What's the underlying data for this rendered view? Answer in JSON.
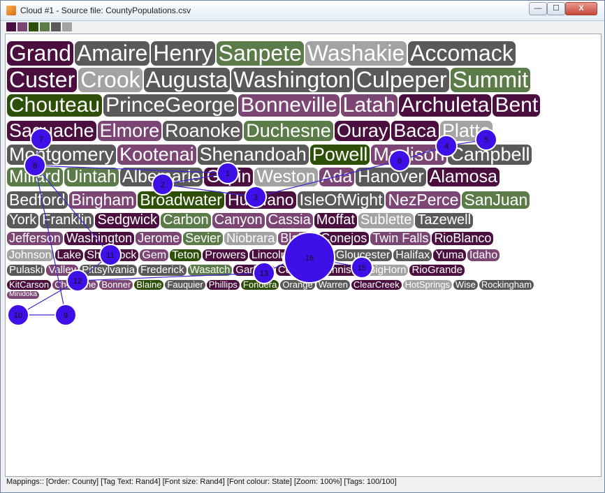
{
  "window": {
    "title": "Cloud #1 - Source file: CountyPopulations.csv"
  },
  "window_controls": {
    "minimize": "—",
    "maximize": "☐",
    "close": "X"
  },
  "palette": [
    "#4b0f3f",
    "#7c4674",
    "#2e4f07",
    "#5b7b48",
    "#595959",
    "#a3a3a3"
  ],
  "status": "Mappings:: [Order: County]  [Tag Text: Rand4]  [Font size: Rand4]  [Font colour: State]  [Zoom: 100%]  [Tags: 100/100]",
  "tags": [
    {
      "text": "Grand",
      "color": "#4b0f3f"
    },
    {
      "text": "Amaire",
      "color": "#595959"
    },
    {
      "text": "Henry",
      "color": "#595959"
    },
    {
      "text": "Sanpete",
      "color": "#5b7b48"
    },
    {
      "text": "Washakie",
      "color": "#a3a3a3"
    },
    {
      "text": "Accomack",
      "color": "#595959"
    },
    {
      "text": "Custer",
      "color": "#4b0f3f"
    },
    {
      "text": "Crook",
      "color": "#a3a3a3"
    },
    {
      "text": "Augusta",
      "color": "#595959"
    },
    {
      "text": "Washington",
      "color": "#595959"
    },
    {
      "text": "Culpeper",
      "color": "#595959"
    },
    {
      "text": "Summit",
      "color": "#5b7b48"
    },
    {
      "text": "Chouteau",
      "color": "#2e4f07"
    },
    {
      "text": "PrinceGeorge",
      "color": "#595959"
    },
    {
      "text": "Bonneville",
      "color": "#7c4674"
    },
    {
      "text": "Latah",
      "color": "#7c4674"
    },
    {
      "text": "Archuleta",
      "color": "#4b0f3f"
    },
    {
      "text": "Bent",
      "color": "#4b0f3f"
    },
    {
      "text": "Saguache",
      "color": "#4b0f3f"
    },
    {
      "text": "Elmore",
      "color": "#7c4674"
    },
    {
      "text": "Roanoke",
      "color": "#595959"
    },
    {
      "text": "Duchesne",
      "color": "#5b7b48"
    },
    {
      "text": "Ouray",
      "color": "#4b0f3f"
    },
    {
      "text": "Baca",
      "color": "#4b0f3f"
    },
    {
      "text": "Platte",
      "color": "#a3a3a3"
    },
    {
      "text": "Montgomery",
      "color": "#595959"
    },
    {
      "text": "Kootenai",
      "color": "#7c4674"
    },
    {
      "text": "Shenandoah",
      "color": "#595959"
    },
    {
      "text": "Powell",
      "color": "#2e4f07"
    },
    {
      "text": "Madison",
      "color": "#7c4674"
    },
    {
      "text": "Campbell",
      "color": "#595959"
    },
    {
      "text": "Millard",
      "color": "#5b7b48"
    },
    {
      "text": "Uintah",
      "color": "#5b7b48"
    },
    {
      "text": "Albemarle",
      "color": "#595959"
    },
    {
      "text": "Gilpin",
      "color": "#4b0f3f"
    },
    {
      "text": "Weston",
      "color": "#a3a3a3"
    },
    {
      "text": "Ada",
      "color": "#7c4674"
    },
    {
      "text": "Hanover",
      "color": "#595959"
    },
    {
      "text": "Alamosa",
      "color": "#4b0f3f"
    },
    {
      "text": "Bedford",
      "color": "#595959"
    },
    {
      "text": "Bingham",
      "color": "#7c4674"
    },
    {
      "text": "Broadwater",
      "color": "#2e4f07"
    },
    {
      "text": "Huerfano",
      "color": "#4b0f3f"
    },
    {
      "text": "IsleOfWight",
      "color": "#595959"
    },
    {
      "text": "NezPerce",
      "color": "#7c4674"
    },
    {
      "text": "SanJuan",
      "color": "#5b7b48"
    },
    {
      "text": "York",
      "color": "#595959"
    },
    {
      "text": "Franklin",
      "color": "#595959"
    },
    {
      "text": "Sedgwick",
      "color": "#4b0f3f"
    },
    {
      "text": "Carbon",
      "color": "#5b7b48"
    },
    {
      "text": "Canyon",
      "color": "#7c4674"
    },
    {
      "text": "Cassia",
      "color": "#7c4674"
    },
    {
      "text": "Moffat",
      "color": "#4b0f3f"
    },
    {
      "text": "Sublette",
      "color": "#a3a3a3"
    },
    {
      "text": "Tazewell",
      "color": "#595959"
    },
    {
      "text": "Jefferson",
      "color": "#7c4674"
    },
    {
      "text": "Washington",
      "color": "#4b0f3f"
    },
    {
      "text": "Jerome",
      "color": "#7c4674"
    },
    {
      "text": "Sevier",
      "color": "#5b7b48"
    },
    {
      "text": "Niobrara",
      "color": "#a3a3a3"
    },
    {
      "text": "Blaine",
      "color": "#7c4674"
    },
    {
      "text": "Conejos",
      "color": "#4b0f3f"
    },
    {
      "text": "Twin Falls",
      "color": "#7c4674"
    },
    {
      "text": "RioBlanco",
      "color": "#4b0f3f"
    },
    {
      "text": "Johnson",
      "color": "#a3a3a3"
    },
    {
      "text": "Lake",
      "color": "#4b0f3f"
    },
    {
      "text": "Shannock",
      "color": "#4b0f3f"
    },
    {
      "text": "Gem",
      "color": "#7c4674"
    },
    {
      "text": "Teton",
      "color": "#2e4f07"
    },
    {
      "text": "Prowers",
      "color": "#4b0f3f"
    },
    {
      "text": "Lincoln",
      "color": "#4b0f3f"
    },
    {
      "text": "Payette",
      "color": "#7c4674"
    },
    {
      "text": "Gloucester",
      "color": "#595959"
    },
    {
      "text": "Halifax",
      "color": "#595959"
    },
    {
      "text": "Yuma",
      "color": "#4b0f3f"
    },
    {
      "text": "Idaho",
      "color": "#7c4674"
    },
    {
      "text": "Pulaski",
      "color": "#595959"
    },
    {
      "text": "Valley",
      "color": "#7c4674"
    },
    {
      "text": "Pittsylvania",
      "color": "#595959"
    },
    {
      "text": "Frederick",
      "color": "#595959"
    },
    {
      "text": "Wasatch",
      "color": "#5b7b48"
    },
    {
      "text": "Garfield",
      "color": "#4b0f3f"
    },
    {
      "text": "Costilla",
      "color": "#4b0f3f"
    },
    {
      "text": "Gunnison",
      "color": "#4b0f3f"
    },
    {
      "text": "BigHorn",
      "color": "#a3a3a3"
    },
    {
      "text": "RioGrande",
      "color": "#4b0f3f"
    },
    {
      "text": "KitCarson",
      "color": "#4b0f3f"
    },
    {
      "text": "Cheyenne",
      "color": "#7c4674"
    },
    {
      "text": "Bonner",
      "color": "#7c4674"
    },
    {
      "text": "Blaine",
      "color": "#2e4f07"
    },
    {
      "text": "Fauquier",
      "color": "#595959"
    },
    {
      "text": "Phillips",
      "color": "#4b0f3f"
    },
    {
      "text": "Fondera",
      "color": "#2e4f07"
    },
    {
      "text": "Orange",
      "color": "#595959"
    },
    {
      "text": "Warren",
      "color": "#595959"
    },
    {
      "text": "ClearCreek",
      "color": "#4b0f3f"
    },
    {
      "text": "HotSprings",
      "color": "#a3a3a3"
    },
    {
      "text": "Wise",
      "color": "#595959"
    },
    {
      "text": "Rockingham",
      "color": "#595959"
    },
    {
      "text": "Minidoka",
      "color": "#7c4674"
    }
  ],
  "markers": [
    {
      "label": "1"
    },
    {
      "label": "2"
    },
    {
      "label": "3"
    },
    {
      "label": "4"
    },
    {
      "label": "5"
    },
    {
      "label": "6"
    },
    {
      "label": "7"
    },
    {
      "label": "8"
    },
    {
      "label": "9"
    },
    {
      "label": "10"
    },
    {
      "label": "11"
    },
    {
      "label": "12"
    },
    {
      "label": "13"
    },
    {
      "label": "14"
    },
    {
      "label": "15"
    },
    {
      "label": "16"
    }
  ]
}
